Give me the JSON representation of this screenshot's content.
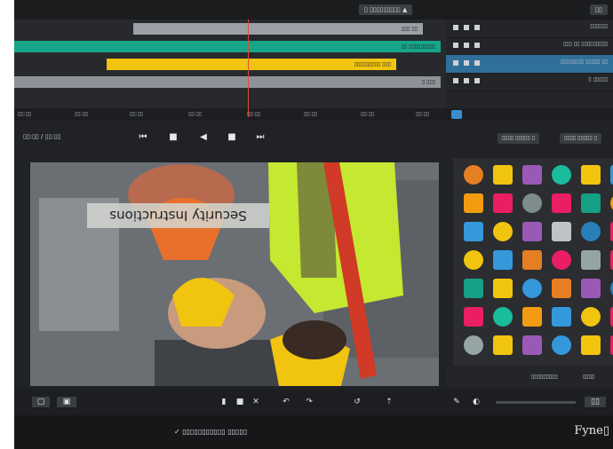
{
  "top": {
    "export_label": "▯ ▯▯▯▯▯▯▯▯▯ ▲",
    "right_label": "▯▯"
  },
  "timeline": {
    "clips": [
      {
        "label": "▯▯▯ ▯▯",
        "color": "#9ba0a6"
      },
      {
        "label": "▯▯ ▯▯▯▯▯▯▯▯▯",
        "color": "#17a589"
      },
      {
        "label": "▯▯▯▯▯▯▯▯▯ ▯▯▯",
        "color": "#f1c40f"
      },
      {
        "label": "▯ ▯▯▯",
        "color": "#8e9399"
      }
    ],
    "track_names": [
      "▯▯▯▯▯▯",
      "▯▯▯ ▯▯ ▯▯▯▯▯▯▯▯▯",
      "▯▯▯▯▯▯▯▯ ▯▯▯▯▯ ▯▯",
      "▯ ▯▯▯▯▯"
    ],
    "ruler_ticks": [
      "▯▯:▯▯",
      "▯▯:▯▯",
      "▯▯:▯▯",
      "▯▯:▯▯",
      "▯▯:▯▯",
      "▯▯:▯▯",
      "▯▯:▯▯",
      "▯▯:▯▯"
    ]
  },
  "transport": {
    "timecode": "▯▯:▯▯ / ▯▯:▯▯"
  },
  "preview": {
    "caption": "Security Instructions"
  },
  "library": {
    "tabs": [
      "▯▯▯▯ ▯▯▯▯▯ ▯",
      "▯▯▯▯ ▯▯▯▯▯ ▯"
    ],
    "footer_left": "▯▯▯▯▯▯▯▯▯",
    "footer_right": "▯▯▯▯",
    "sticker_colors": [
      [
        "#e67e22",
        "#f1c40f",
        "#9b59b6",
        "#1abc9c",
        "#f1c40f",
        "#3498db",
        "#e91e63"
      ],
      [
        "#f39c12",
        "#e91e63",
        "#7f8c8d",
        "#e91e63",
        "#16a085",
        "#f39c12",
        "#1abc9c"
      ],
      [
        "#3498db",
        "#f1c40f",
        "#9b59b6",
        "#bdc3c7",
        "#2980b9",
        "#e91e63",
        "#f1c40f"
      ],
      [
        "#f1c40f",
        "#3498db",
        "#e67e22",
        "#e91e63",
        "#95a5a6",
        "#e91e63",
        "#16a085"
      ],
      [
        "#16a085",
        "#f1c40f",
        "#3498db",
        "#e67e22",
        "#9b59b6",
        "#2980b9",
        "#1abc9c"
      ],
      [
        "#e91e63",
        "#1abc9c",
        "#f39c12",
        "#3498db",
        "#f1c40f",
        "#e91e63",
        "#f39c12"
      ],
      [
        "#95a5a6",
        "#f1c40f",
        "#9b59b6",
        "#3498db",
        "#f1c40f",
        "#e91e63",
        "#16a085"
      ]
    ]
  },
  "toolbar": {
    "status": "✓ ▯▯▯▯▯▯▯▯▯▯▯ ▯▯▯▯▯"
  },
  "brand": "Fyne▯"
}
